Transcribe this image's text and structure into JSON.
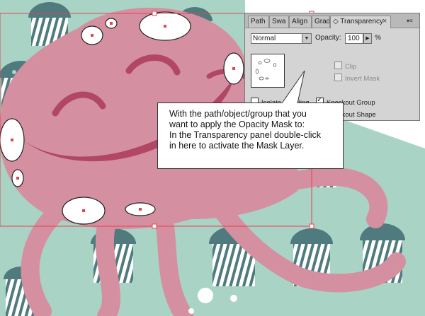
{
  "panel": {
    "tabs": [
      {
        "label": "Path"
      },
      {
        "label": "Swa"
      },
      {
        "label": "Align"
      },
      {
        "label": "Grad"
      },
      {
        "label": "◇ Transparency"
      }
    ],
    "close_glyph": "×",
    "menu_glyph": "▾≡",
    "blend_mode": "Normal",
    "opacity_label": "Opacity:",
    "opacity_value": "100",
    "opacity_unit": "%",
    "clip_label": "Clip",
    "invert_mask_label": "Invert Mask",
    "isolate_blending_label": "Isolate Blending",
    "knockout_group_label": "Knockout Group",
    "knockout_shape_label": "Knockout Shape"
  },
  "callout": {
    "lines": [
      "With the path/object/group that you",
      "want to apply the Opacity Mask to:",
      "In the Transparency panel double-click",
      "in here to activate the Mask Layer."
    ]
  },
  "colors": {
    "background": "#a9d3c4",
    "octopus": "#d48fa0",
    "mouth": "#b14764",
    "stripes": "#4f7a7e",
    "selection": "#e8424f"
  },
  "icons": [
    "blend-dropdown-arrow-icon",
    "opacity-stepper-arrow-icon",
    "panel-menu-icon",
    "close-icon",
    "transparency-tab-icon"
  ]
}
